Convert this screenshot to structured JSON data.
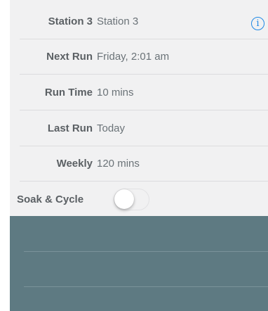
{
  "station": {
    "label": "Station 3",
    "value": "Station 3",
    "info_icon": "info-circle-icon",
    "info_glyph": "i"
  },
  "next_run": {
    "label": "Next Run",
    "value": "Friday, 2:01 am"
  },
  "run_time": {
    "label": "Run Time",
    "value": "10 mins"
  },
  "last_run": {
    "label": "Last Run",
    "value": "Today"
  },
  "weekly": {
    "label": "Weekly",
    "value": "120 mins"
  },
  "soak_cycle": {
    "label": "Soak & Cycle",
    "enabled": false
  },
  "colors": {
    "accent": "#1e88e5",
    "panel": "#f1f1f2",
    "footer": "#5e7a82"
  }
}
